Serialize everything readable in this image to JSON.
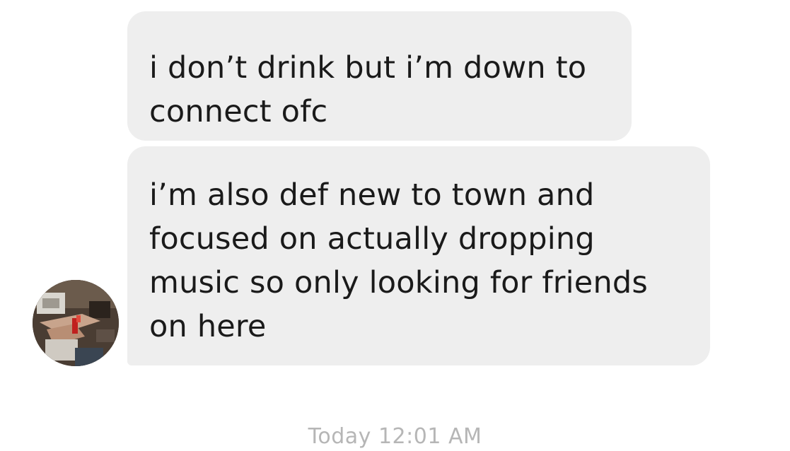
{
  "messages": [
    {
      "lines": [
        "i don’t drink but i’m down to",
        "connect ofc"
      ]
    },
    {
      "lines": [
        "i’m also def new to town and",
        "focused on actually dropping",
        "music so only looking for friends",
        "on here"
      ]
    }
  ],
  "timestamp": {
    "day": "Today",
    "time": "12:01 AM"
  },
  "colors": {
    "bubble_background": "#eeeeee",
    "message_text": "#1a1a1a",
    "timestamp_text": "#b6b6b6"
  },
  "icons": {
    "avatar": "sender-profile-photo"
  }
}
